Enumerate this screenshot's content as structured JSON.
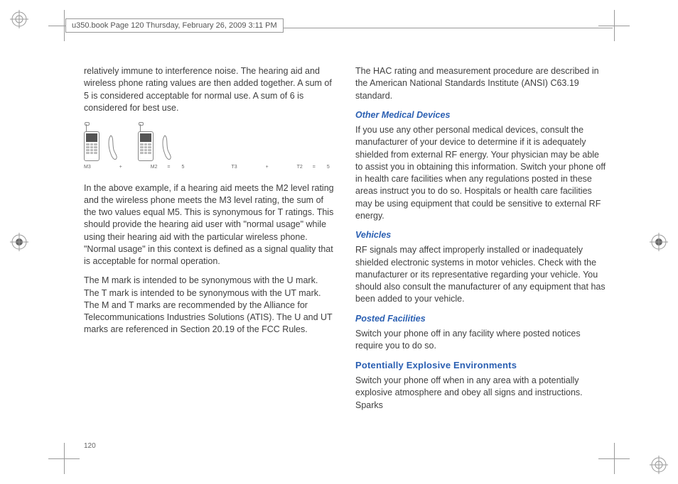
{
  "header": {
    "filepath": "u350.book  Page 120  Thursday, February 26, 2009  3:11 PM"
  },
  "page_number": "120",
  "left_col": {
    "p1": "relatively immune to interference noise. The hearing aid and wireless phone rating values are then added together. A sum of 5 is considered acceptable for normal use. A sum of 6 is considered for best use.",
    "diagram_eq": {
      "m3": "M3",
      "plus1": "+",
      "m2": "M2",
      "eq1": "=",
      "five1": "5",
      "t3": "T3",
      "plus2": "+",
      "t2": "T2",
      "eq2": "=",
      "five2": "5"
    },
    "p2": "In the above example, if a hearing aid meets the M2 level rating and the wireless phone meets the M3 level rating, the sum of the two values equal M5. This is synonymous for T ratings. This should provide the hearing aid user with \"normal usage\" while using their hearing aid with the particular wireless phone. \"Normal usage\" in this context is defined as a signal quality that is acceptable for normal operation.",
    "p3": "The M mark is intended to be synonymous with the U mark. The T mark is intended to be synonymous with the UT mark. The M and T marks are recommended by the Alliance for Telecommunications Industries Solutions (ATIS). The U and UT marks are referenced in Section 20.19 of the FCC Rules."
  },
  "right_col": {
    "p1": "The HAC rating and measurement procedure are described in the American National Standards Institute (ANSI) C63.19 standard.",
    "h1": "Other Medical Devices",
    "p2": "If you use any other personal medical devices, consult the manufacturer of your device to determine if it is adequately shielded from external RF energy. Your physician may be able to assist you in obtaining this information. Switch your phone off in health care facilities when any regulations posted in these areas instruct you to do so. Hospitals or health care facilities may be using equipment that could be sensitive to external RF energy.",
    "h2": "Vehicles",
    "p3": "RF signals may affect improperly installed or inadequately shielded electronic systems in motor vehicles. Check with the manufacturer or its representative regarding your vehicle. You should also consult the manufacturer of any equipment that has been added to your vehicle.",
    "h3": "Posted Facilities",
    "p4": "Switch your phone off in any facility where posted notices require you to do so.",
    "h4": "Potentially Explosive Environments",
    "p5": "Switch your phone off when in any area with a potentially explosive atmosphere and obey all signs and instructions. Sparks"
  }
}
